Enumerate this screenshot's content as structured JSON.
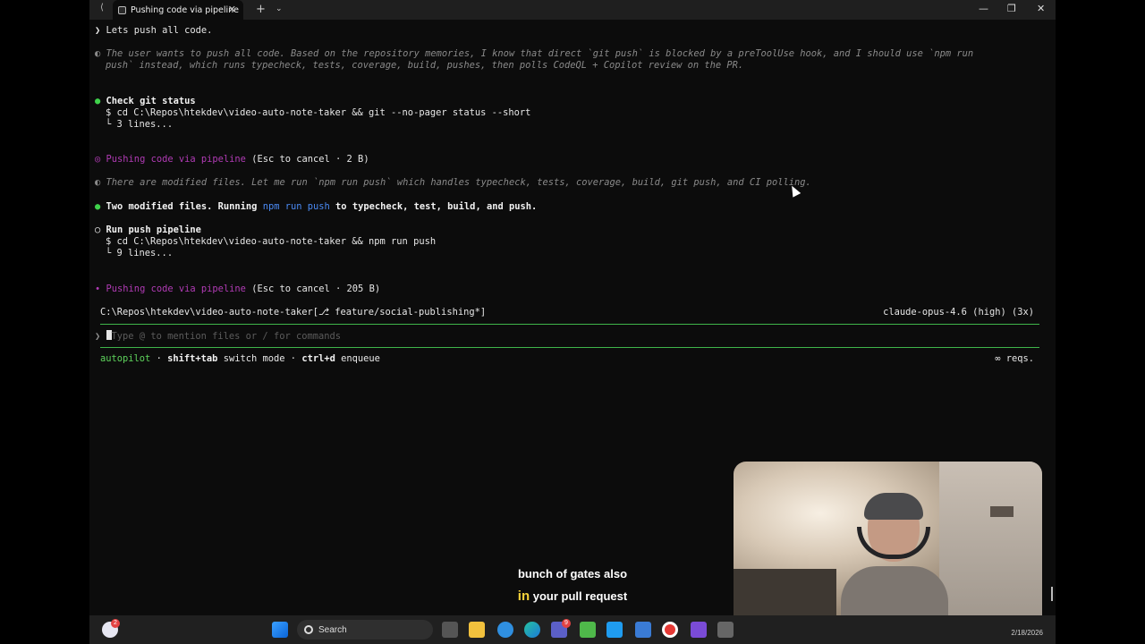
{
  "window": {
    "tab_title": "Pushing code via pipeline",
    "tab_back_label": "⟨",
    "tab_close_label": "✕",
    "new_tab_label": "+",
    "dropdown_label": "⌄",
    "minimize_label": "—",
    "maximize_label": "❐",
    "close_label": "✕"
  },
  "terminal": {
    "user_prompt_glyph": "❯",
    "user_message": "Lets push all code.",
    "thinking_glyph": "◐",
    "thinking_1_line1": "The user wants to push all code. Based on the repository memories, I know that direct `git push` is blocked by a preToolUse hook, and I should use `npm run",
    "thinking_1_line2": "push` instead, which runs typecheck, tests, coverage, build, pushes, then polls CodeQL + Copilot review on the PR.",
    "step1_bullet": "●",
    "step1_title": "Check git status",
    "step1_cmd": "$ cd C:\\Repos\\htekdev\\video-auto-note-taker && git --no-pager status --short",
    "step1_result": "└ 3 lines...",
    "progress1_glyph": "◎",
    "progress1_label": "Pushing code via pipeline",
    "progress1_hint": "(Esc to cancel · 2 B)",
    "thinking_2": "There are modified files. Let me run `npm run push` which handles typecheck, tests, coverage, build, git push, and CI polling.",
    "message_bullet": "●",
    "message_prefix": "Two modified files. Running",
    "message_cmd": "npm run push",
    "message_suffix": "to typecheck, test, build, and push.",
    "step2_bullet": "○",
    "step2_title": "Run push pipeline",
    "step2_cmd": "$ cd C:\\Repos\\htekdev\\video-auto-note-taker && npm run push",
    "step2_result": "└ 9 lines...",
    "progress2_glyph": "∙",
    "progress2_label": "Pushing code via pipeline",
    "progress2_hint": "(Esc to cancel · 205 B)"
  },
  "statusbar": {
    "path": "C:\\Repos\\htekdev\\video-auto-note-taker[⎇ feature/social-publishing*]",
    "model": "claude-opus-4.6 (high) (3x)"
  },
  "input": {
    "prompt_glyph": "❯",
    "placeholder": "Type @ to mention files or / for commands"
  },
  "footer": {
    "mode": "autopilot",
    "sep": "·",
    "key1": "shift+tab",
    "key1_desc": "switch mode",
    "key2": "ctrl+d",
    "key2_desc": "enqueue",
    "reqs": "∞ reqs."
  },
  "captions": {
    "line1": "bunch of gates also",
    "line2_highlight": "in",
    "line2_rest": "your pull request"
  },
  "taskbar": {
    "search_label": "Search",
    "weather_badge": "2",
    "teams_badge": "9",
    "clock_date": "2/18/2026"
  },
  "colors": {
    "terminal_bg": "#0c0c0c",
    "green": "#3fd24b",
    "purple": "#b13bb5",
    "blue": "#4b8bf5"
  }
}
